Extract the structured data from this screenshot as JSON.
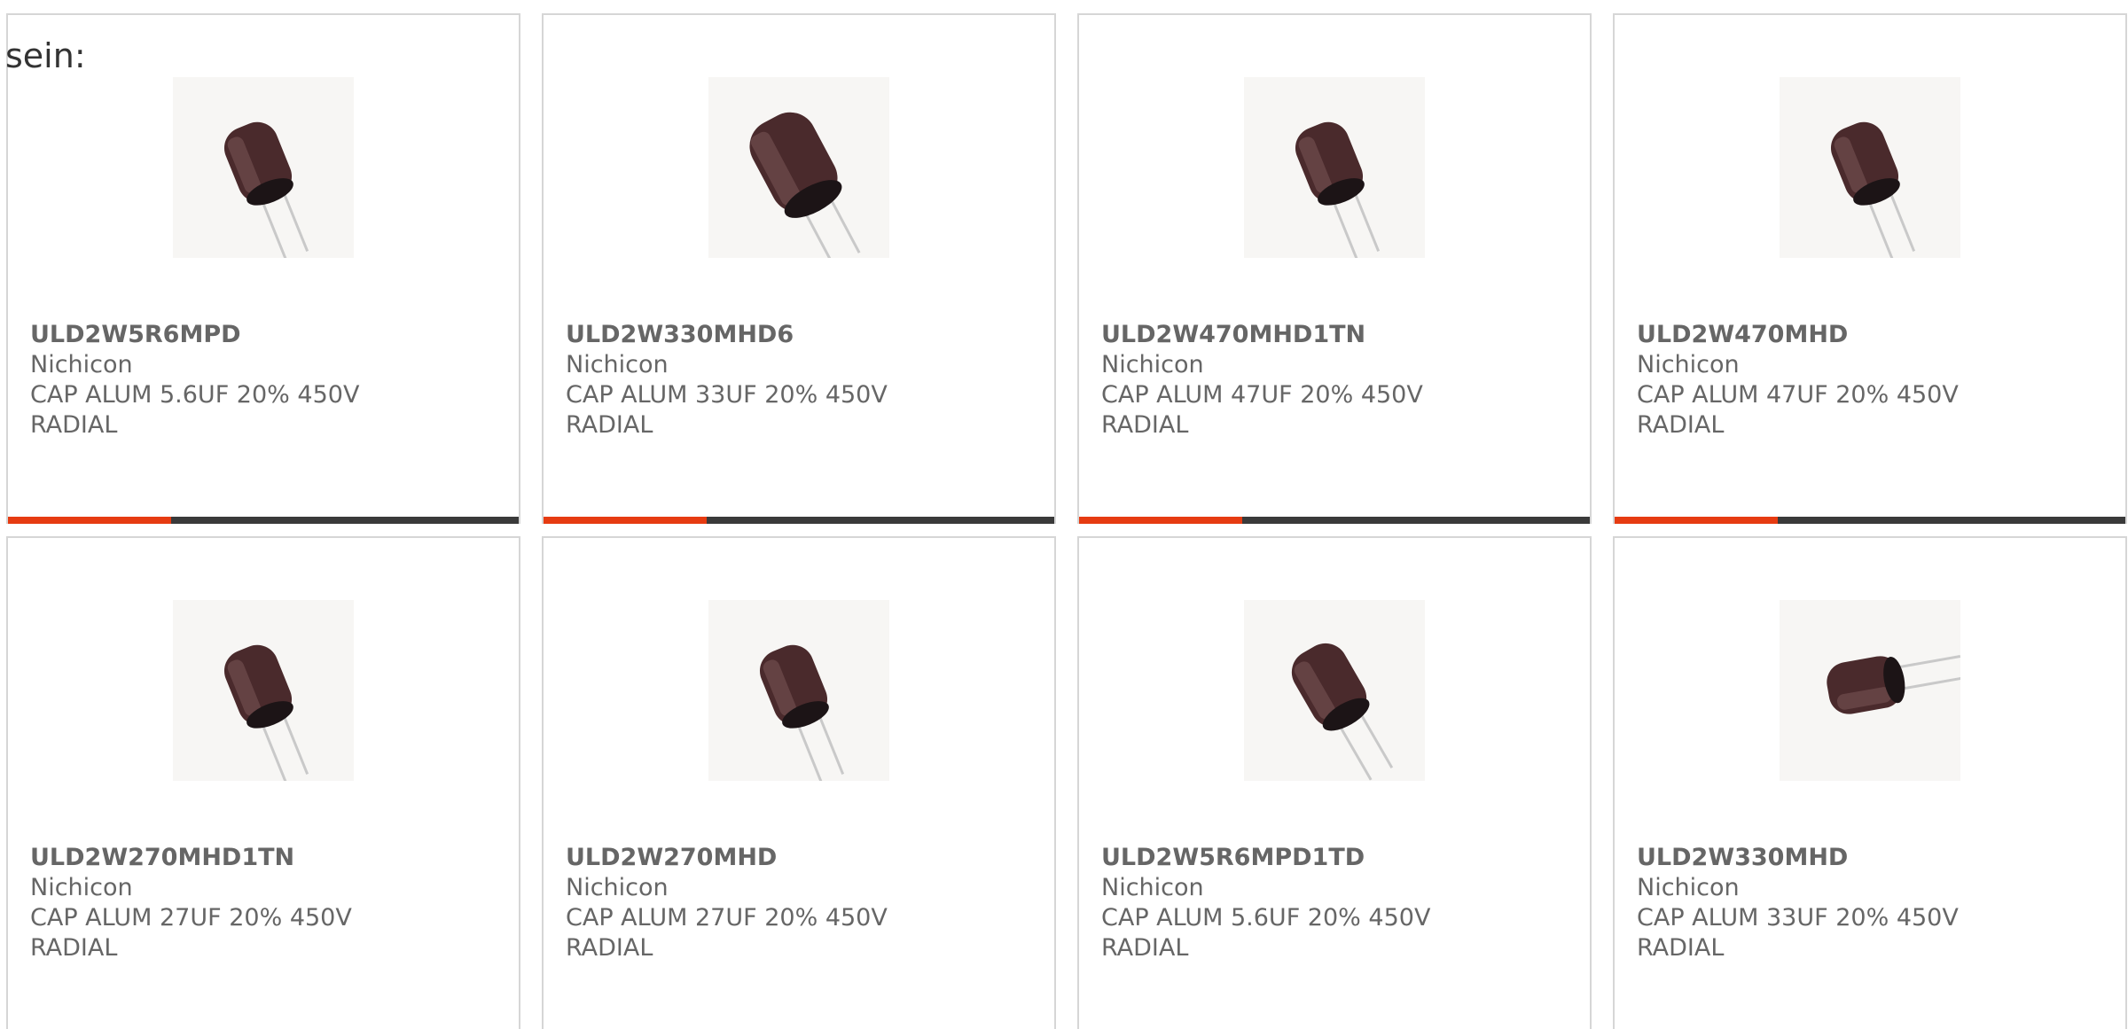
{
  "intro_text": "sein:",
  "colors": {
    "accent": "#e63b11",
    "bar_track": "#3a3a3a",
    "card_border": "#d6d6d6",
    "text": "#666666"
  },
  "products": [
    {
      "part_number": "ULD2W5R6MPD",
      "manufacturer": "Nichicon",
      "description_line1": "CAP ALUM 5.6UF 20% 450V",
      "description_line2": "RADIAL",
      "image_icon": "capacitor-icon",
      "bar_fill": 0.32
    },
    {
      "part_number": "ULD2W330MHD6",
      "manufacturer": "Nichicon",
      "description_line1": "CAP ALUM 33UF 20% 450V",
      "description_line2": "RADIAL",
      "image_icon": "capacitor-icon",
      "bar_fill": 0.32
    },
    {
      "part_number": "ULD2W470MHD1TN",
      "manufacturer": "Nichicon",
      "description_line1": "CAP ALUM 47UF 20% 450V",
      "description_line2": "RADIAL",
      "image_icon": "capacitor-icon",
      "bar_fill": 0.32
    },
    {
      "part_number": "ULD2W470MHD",
      "manufacturer": "Nichicon",
      "description_line1": "CAP ALUM 47UF 20% 450V",
      "description_line2": "RADIAL",
      "image_icon": "capacitor-icon",
      "bar_fill": 0.32
    },
    {
      "part_number": "ULD2W270MHD1TN",
      "manufacturer": "Nichicon",
      "description_line1": "CAP ALUM 27UF 20% 450V",
      "description_line2": "RADIAL",
      "image_icon": "capacitor-icon",
      "bar_fill": 0.32
    },
    {
      "part_number": "ULD2W270MHD",
      "manufacturer": "Nichicon",
      "description_line1": "CAP ALUM 27UF 20% 450V",
      "description_line2": "RADIAL",
      "image_icon": "capacitor-icon",
      "bar_fill": 0.32
    },
    {
      "part_number": "ULD2W5R6MPD1TD",
      "manufacturer": "Nichicon",
      "description_line1": "CAP ALUM 5.6UF 20% 450V",
      "description_line2": "RADIAL",
      "image_icon": "capacitor-icon",
      "bar_fill": 0.32
    },
    {
      "part_number": "ULD2W330MHD",
      "manufacturer": "Nichicon",
      "description_line1": "CAP ALUM 33UF 20% 450V",
      "description_line2": "RADIAL",
      "image_icon": "capacitor-icon",
      "bar_fill": 0.32
    }
  ]
}
